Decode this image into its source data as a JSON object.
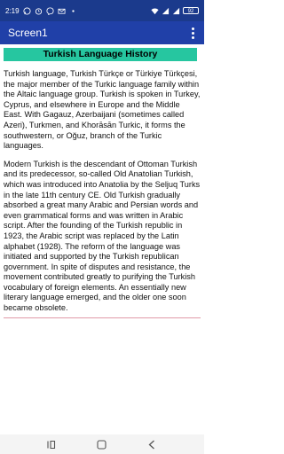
{
  "status_bar": {
    "time": "2:19",
    "icons_left": [
      "whatsapp-icon",
      "alarm-icon",
      "messenger-icon",
      "mail-icon",
      "dot-icon"
    ],
    "battery": "92"
  },
  "app_bar": {
    "title": "Screen1",
    "menu_icon": "overflow-menu-icon"
  },
  "content": {
    "heading": "Turkish Language History",
    "paragraph_1": "Turkish language, Turkish Türkçe or Türkiye Türkçesi, the major member of the Turkic language family within the Altaic language group. Turkish is spoken in Turkey, Cyprus, and elsewhere in Europe and the Middle East. With Gagauz, Azerbaijani (sometimes called Azeri), Turkmen, and Khorāsān Turkic, it forms the southwestern, or Oğuz, branch of the Turkic languages.",
    "paragraph_2": "Modern Turkish is the descendant of Ottoman Turkish and its predecessor, so-called Old Anatolian Turkish, which was introduced into Anatolia by the Seljuq Turks in the late 11th century CE. Old Turkish gradually absorbed a great many Arabic and Persian words and even grammatical forms and was written in Arabic script. After the founding of the Turkish republic in 1923, the Arabic script was replaced by the Latin alphabet (1928). The reform of the language was initiated and supported by the Turkish republican government. In spite of disputes and resistance, the movement contributed greatly to purifying the Turkish vocabulary of foreign elements. An essentially new literary language emerged, and the older one soon became obsolete."
  },
  "nav_bar": {
    "items": [
      "recents-icon",
      "home-icon",
      "back-icon"
    ]
  },
  "colors": {
    "status_bar": "#1b3a8c",
    "app_bar": "#2040a8",
    "heading_bg": "#26c6a0",
    "divider": "#e09aa8"
  }
}
